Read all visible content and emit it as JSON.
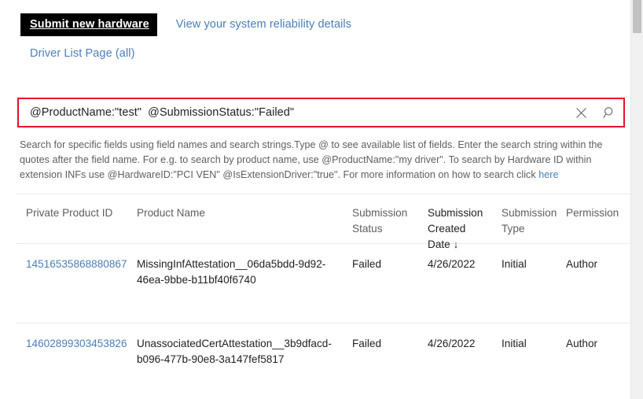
{
  "top_links": {
    "submit_new_hardware": "Submit new hardware",
    "view_reliability": "View your system reliability details",
    "driver_list_page": "Driver List Page (all)"
  },
  "search": {
    "value": "@ProductName:\"test\"  @SubmissionStatus:\"Failed\"",
    "placeholder": "",
    "clear_icon": "close-icon",
    "search_icon": "search-icon",
    "border_color": "#e81123"
  },
  "help": {
    "text": "Search for specific fields using field names and search strings.Type @ to see available list of fields. Enter the search string within the quotes after the field name. For e.g. to search by product name, use @ProductName:\"my driver\". To search by Hardware ID within extension INFs use @HardwareID:\"PCI VEN\" @IsExtensionDriver:\"true\". For more information on how to search click ",
    "link_label": "here",
    "link_color": "#4a7ebb"
  },
  "table": {
    "columns": [
      {
        "label": "Private Product ID",
        "sorted": false,
        "sort_arrow": ""
      },
      {
        "label": "Product Name",
        "sorted": false,
        "sort_arrow": ""
      },
      {
        "label": "Submission Status",
        "sorted": false,
        "sort_arrow": ""
      },
      {
        "label": "Submission Created Date",
        "sorted": true,
        "sort_arrow": "↓"
      },
      {
        "label": "Submission Type",
        "sorted": false,
        "sort_arrow": ""
      },
      {
        "label": "Permission",
        "sorted": false,
        "sort_arrow": ""
      }
    ],
    "rows": [
      {
        "private_product_id": "14516535868880867",
        "product_name": "MissingInfAttestation__06da5bdd-9d92-46ea-9bbe-b11bf40f6740",
        "submission_status": "Failed",
        "submission_created_date": "4/26/2022",
        "submission_type": "Initial",
        "permission": "Author"
      },
      {
        "private_product_id": "14602899303453826",
        "product_name": "UnassociatedCertAttestation__3b9dfacd-b096-477b-90e8-3a147fef5817",
        "submission_status": "Failed",
        "submission_created_date": "4/26/2022",
        "submission_type": "Initial",
        "permission": "Author"
      }
    ]
  },
  "scrollbar": {
    "track_color": "#f1f1f1",
    "thumb_color": "#c1c1c1"
  }
}
